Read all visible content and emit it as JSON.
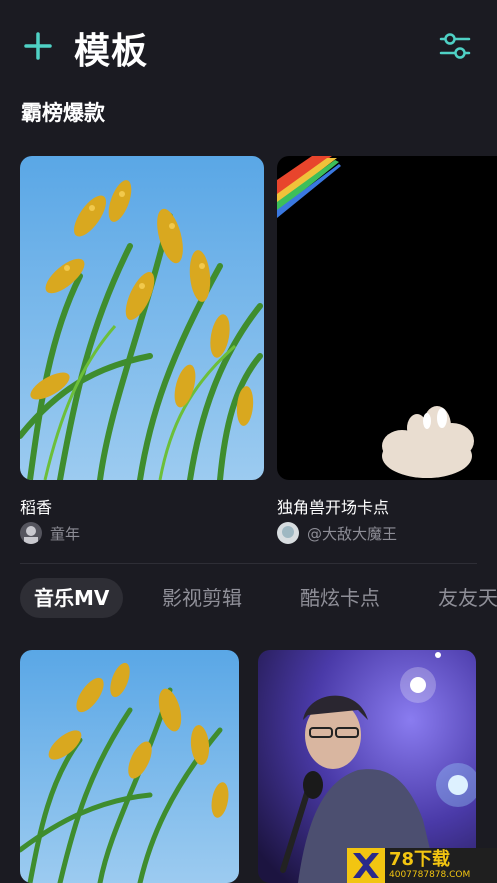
{
  "header": {
    "title": "模板",
    "add_icon": "plus-icon",
    "filter_icon": "sliders-icon",
    "accent_color": "#4fd1c5"
  },
  "section": {
    "title": "霸榜爆款"
  },
  "featured_cards": [
    {
      "title": "稻香",
      "author": "童年"
    },
    {
      "title": "独角兽开场卡点",
      "author": "@大敌大魔王"
    }
  ],
  "tabs": [
    {
      "label": "音乐MV",
      "active": true
    },
    {
      "label": "影视剪辑",
      "active": false
    },
    {
      "label": "酷炫卡点",
      "active": false
    },
    {
      "label": "友友天",
      "active": false
    }
  ],
  "watermark": {
    "title": "78下载",
    "url": "4007787878.COM"
  }
}
